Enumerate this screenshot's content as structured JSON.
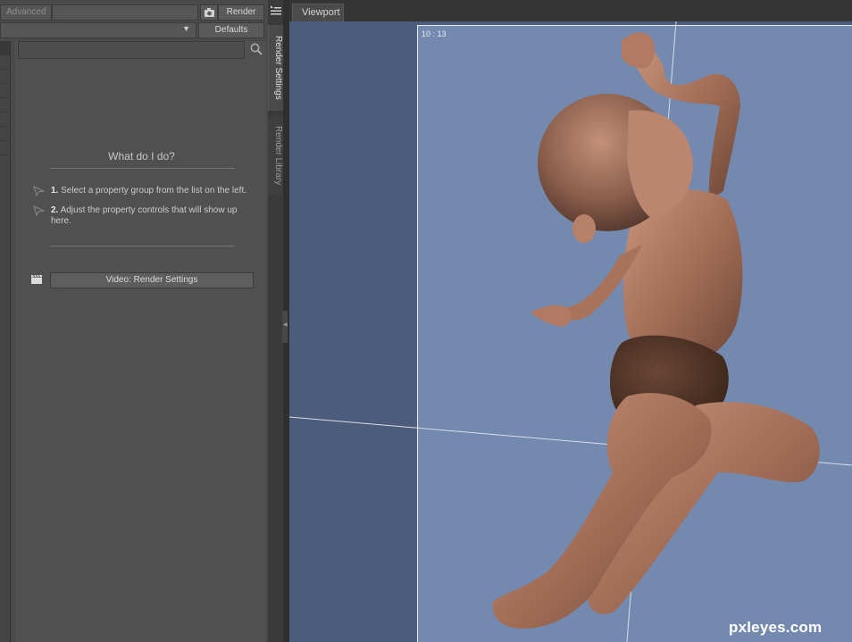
{
  "render_panel": {
    "advanced_tab_label": "Advanced",
    "render_button_label": "Render",
    "defaults_button_label": "Defaults",
    "help_title": "What do I do?",
    "steps": [
      {
        "num": "1.",
        "text": "Select a property group from the list on the left."
      },
      {
        "num": "2.",
        "text": "Adjust the property controls that will show up here."
      }
    ],
    "video_button_label": "Video: Render Settings"
  },
  "side_tabs": {
    "render_settings": "Render Settings",
    "render_library": "Render Library"
  },
  "viewport": {
    "tab_label": "Viewport",
    "frame_counter": "10 : 13"
  },
  "watermark": "pxleyes.com",
  "colors": {
    "panel_bg": "#505050",
    "viewport_bg": "#4c5c7b",
    "render_frame_bg": "#7489ae",
    "skin": "#b8826a"
  },
  "icons": [
    "camera-icon",
    "chevron-down-icon",
    "search-icon",
    "arrow-cursor-icon",
    "clapperboard-icon",
    "menu-icon",
    "collapse-arrow-icon"
  ]
}
